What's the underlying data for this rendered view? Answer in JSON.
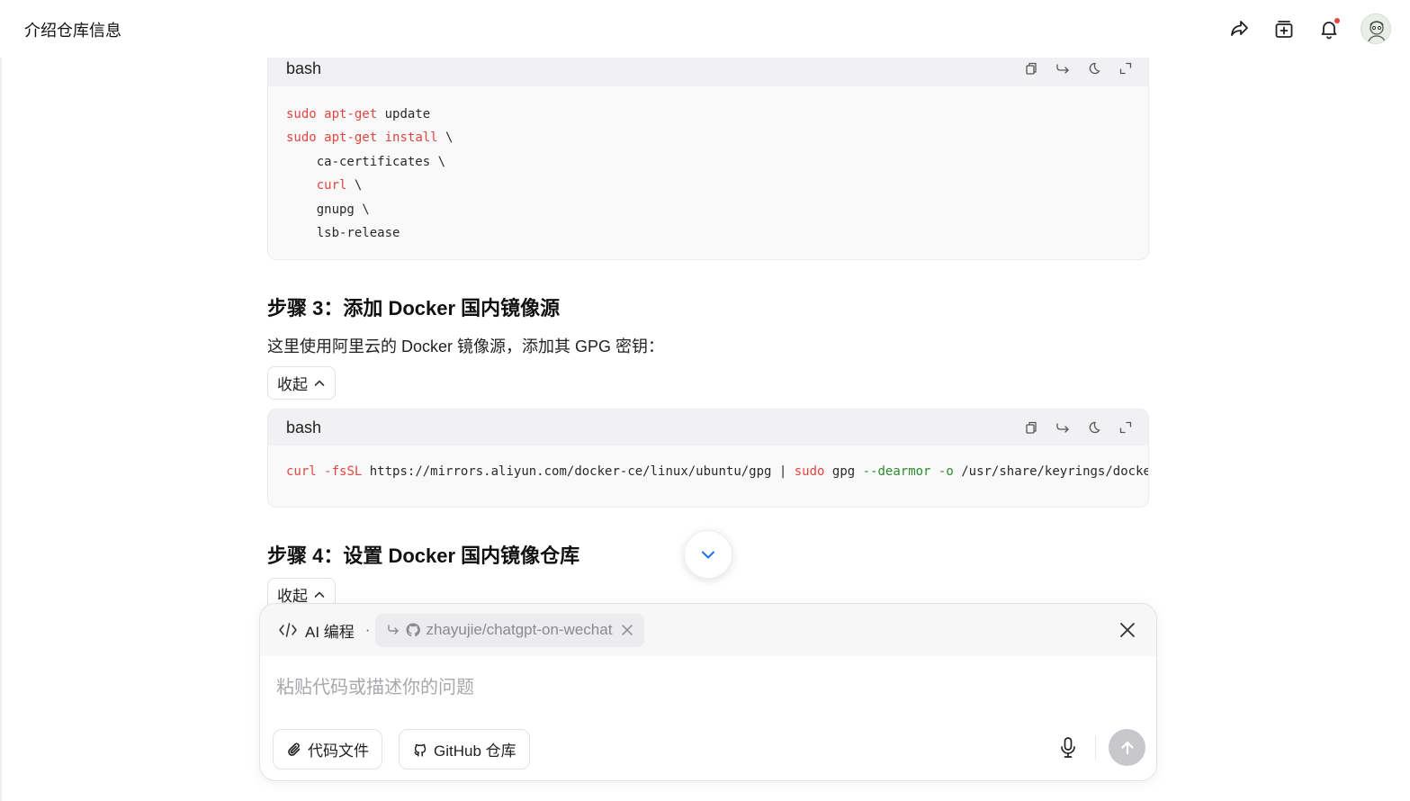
{
  "header": {
    "title": "介绍仓库信息",
    "icons": [
      "share-icon",
      "new-chat-icon",
      "bell-icon",
      "avatar"
    ]
  },
  "code_block_1": {
    "lang": "bash",
    "tools": [
      "copy-icon",
      "wrap-icon",
      "theme-icon",
      "expand-icon"
    ],
    "lines": [
      [
        {
          "t": "sudo",
          "c": "red"
        },
        {
          "t": " "
        },
        {
          "t": "apt-get",
          "c": "red"
        },
        {
          "t": " update"
        }
      ],
      [
        {
          "t": "sudo",
          "c": "red"
        },
        {
          "t": " "
        },
        {
          "t": "apt-get",
          "c": "red"
        },
        {
          "t": " "
        },
        {
          "t": "install",
          "c": "red"
        },
        {
          "t": " \\"
        }
      ],
      [
        {
          "t": "    ca-certificates \\"
        }
      ],
      [
        {
          "t": "    "
        },
        {
          "t": "curl",
          "c": "red"
        },
        {
          "t": " \\"
        }
      ],
      [
        {
          "t": "    gnupg \\"
        }
      ],
      [
        {
          "t": "    lsb-release"
        }
      ]
    ]
  },
  "step3": {
    "heading": "步骤 3：添加 Docker 国内镜像源",
    "desc": "这里使用阿里云的 Docker 镜像源，添加其 GPG 密钥：",
    "collapse_label": "收起"
  },
  "code_block_2": {
    "lang": "bash",
    "lines": [
      [
        {
          "t": "curl",
          "c": "red"
        },
        {
          "t": " "
        },
        {
          "t": "-fsSL",
          "c": "red"
        },
        {
          "t": " https://mirrors.aliyun.com/docker-ce/linux/ubuntu/gpg | "
        },
        {
          "t": "sudo",
          "c": "red"
        },
        {
          "t": " gpg "
        },
        {
          "t": "--dearmor",
          "c": "green"
        },
        {
          "t": " "
        },
        {
          "t": "-o",
          "c": "green"
        },
        {
          "t": " /usr/share/keyrings/docker-archive-keyring.gpg"
        }
      ]
    ]
  },
  "step4": {
    "heading": "步骤 4：设置 Docker 国内镜像仓库",
    "collapse_label": "收起"
  },
  "composer": {
    "mode_label": "AI 编程",
    "separator": "·",
    "repo": "zhayujie/chatgpt-on-wechat",
    "placeholder": "粘贴代码或描述你的问题",
    "attach_label": "代码文件",
    "github_label": "GitHub 仓库"
  },
  "colors": {
    "token_red": "#e2463f",
    "token_green": "#2e8b2e",
    "accent_blue": "#1f6feb",
    "send_disabled": "#c8c8cc"
  }
}
